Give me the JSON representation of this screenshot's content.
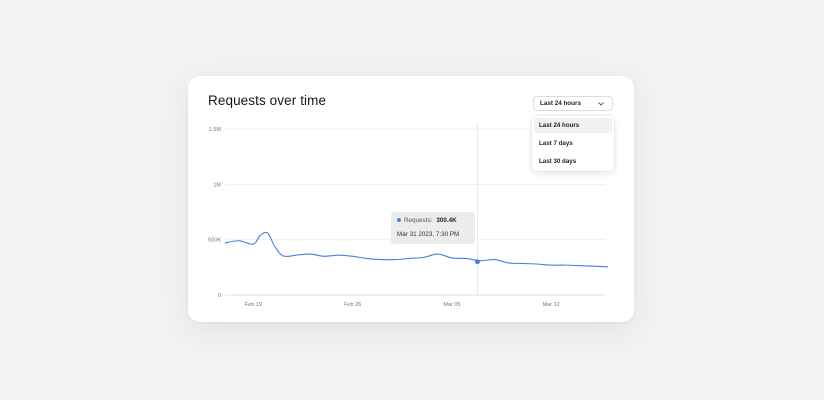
{
  "card": {
    "title": "Requests over time"
  },
  "range_select": {
    "selected": "Last 24 hours",
    "options": [
      "Last 24 hours",
      "Last 7 days",
      "Last 30 days"
    ]
  },
  "tooltip": {
    "series": "Requests:",
    "value": "300.4K",
    "timestamp": "Mar 31 2023, 7:30 PM"
  },
  "colors": {
    "line": "#4a7ee0",
    "tooltip_bg": "#ececec",
    "grid": "#eeeeee"
  },
  "chart_data": {
    "type": "line",
    "title": "Requests over time",
    "ylim": [
      0,
      1500000
    ],
    "y_ticks": [
      0,
      500000,
      1000000,
      1500000
    ],
    "y_tick_labels": [
      "0",
      "500K",
      "1M",
      "1.5M"
    ],
    "x_tick_labels": [
      "Feb 19",
      "Feb 26",
      "Mar 05",
      "Mar 12"
    ],
    "x_tick_days": [
      2,
      9,
      16,
      23
    ],
    "grid": true,
    "series": [
      {
        "name": "Requests",
        "x": [
          0,
          1,
          2,
          2.5,
          3,
          3.5,
          4,
          4.5,
          5,
          6,
          7,
          8,
          9,
          10,
          11,
          12,
          13,
          14,
          15,
          16,
          17,
          18,
          19,
          20,
          21,
          22,
          23,
          24,
          25,
          26,
          27
        ],
        "values": [
          470000,
          490000,
          460000,
          540000,
          560000,
          440000,
          360000,
          350000,
          360000,
          370000,
          350000,
          360000,
          350000,
          330000,
          320000,
          320000,
          330000,
          340000,
          370000,
          335000,
          330000,
          310000,
          320000,
          290000,
          285000,
          280000,
          270000,
          270000,
          265000,
          260000,
          255000
        ]
      }
    ],
    "highlight": {
      "x": 17.8,
      "value": 300400
    }
  }
}
